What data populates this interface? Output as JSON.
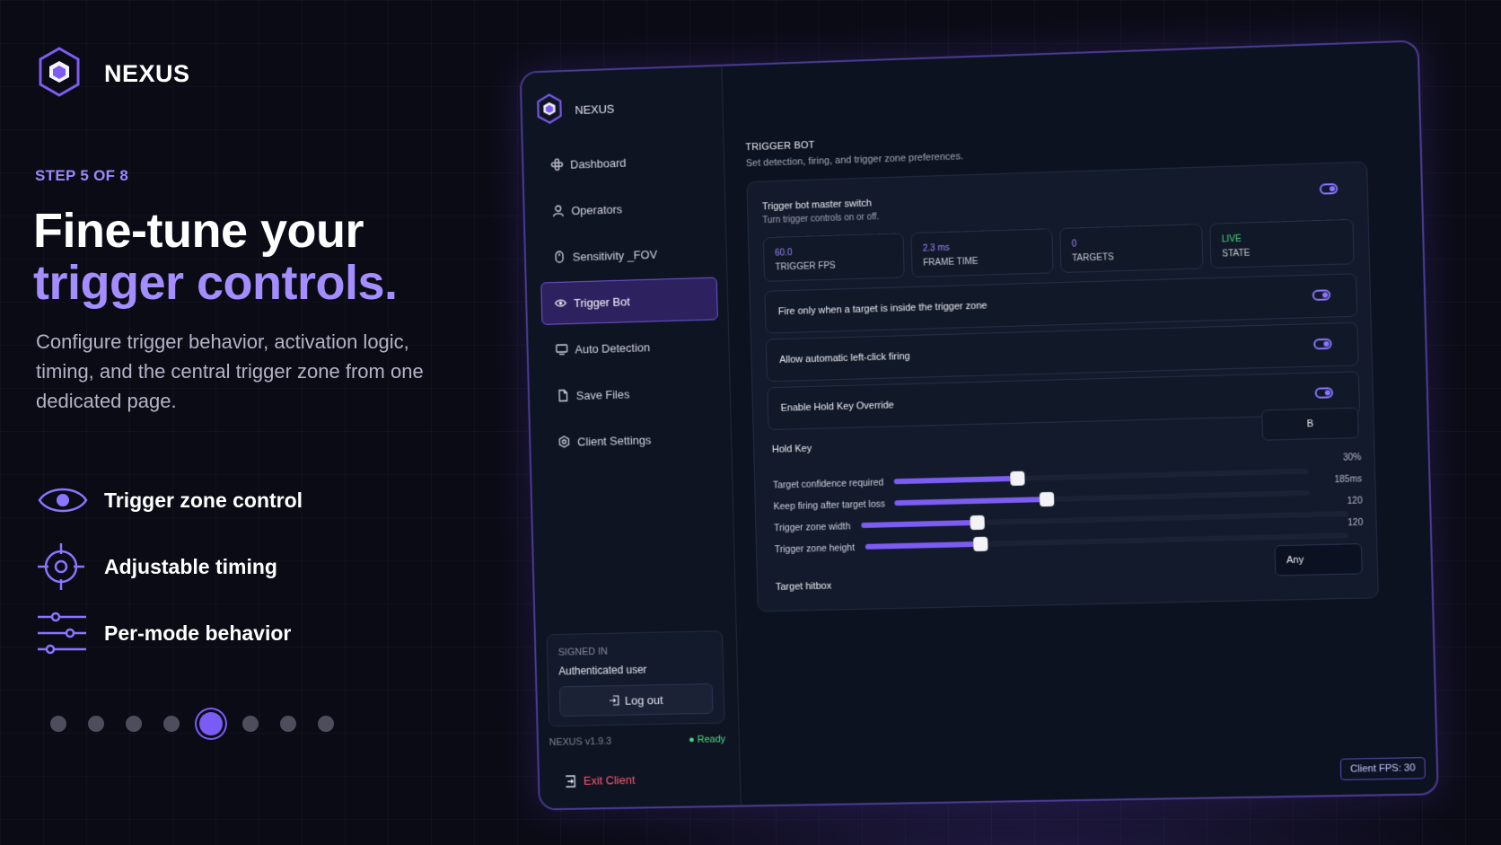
{
  "brand": {
    "name": "NEXUS"
  },
  "step": "STEP 5 OF 8",
  "headline": {
    "line1": "Fine-tune your",
    "line2": "trigger controls."
  },
  "lead": "Configure trigger behavior, activation logic, timing, and the central trigger zone from one dedicated page.",
  "features": [
    {
      "icon": "eye-icon",
      "label": "Trigger zone control"
    },
    {
      "icon": "crosshair-icon",
      "label": "Adjustable timing"
    },
    {
      "icon": "sliders-icon",
      "label": "Per-mode behavior"
    }
  ],
  "pagination": {
    "total": 8,
    "current": 5
  },
  "colors": {
    "accent": "#7c5cf2",
    "accent_light": "#a48dff",
    "ready": "#4ade80",
    "danger": "#ff5a6e",
    "background": "#0b0b16"
  },
  "app": {
    "brand_name": "NEXUS",
    "nav": [
      {
        "icon": "dashboard-icon",
        "label": "Dashboard"
      },
      {
        "icon": "user-icon",
        "label": "Operators"
      },
      {
        "icon": "mouse-icon",
        "label": "Sensitivity _FOV"
      },
      {
        "icon": "eye-icon",
        "label": "Trigger Bot",
        "active": true
      },
      {
        "icon": "monitor-icon",
        "label": "Auto Detection"
      },
      {
        "icon": "file-icon",
        "label": "Save Files"
      },
      {
        "icon": "settings-icon",
        "label": "Client Settings"
      }
    ],
    "signed_in": {
      "caption": "SIGNED IN",
      "user": "Authenticated user",
      "logout_label": "Log out"
    },
    "version": "NEXUS v1.9.3",
    "status": "● Ready",
    "exit_label": "Exit Client",
    "client_fps": "Client FPS: 30"
  },
  "page": {
    "title": "TRIGGER BOT",
    "subtitle": "Set detection, firing, and trigger zone preferences.",
    "master": {
      "title": "Trigger bot master switch",
      "subtitle": "Turn trigger controls on or off.",
      "enabled": true
    },
    "stats": [
      {
        "value": "60.0",
        "label": "TRIGGER FPS"
      },
      {
        "value": "2.3 ms",
        "label": "FRAME TIME"
      },
      {
        "value": "0",
        "label": "TARGETS"
      },
      {
        "value": "LIVE",
        "label": "STATE"
      }
    ],
    "toggles": [
      {
        "label": "Fire only when a target is inside the trigger zone",
        "enabled": true
      },
      {
        "label": "Allow automatic left-click firing",
        "enabled": true
      },
      {
        "label": "Enable Hold Key Override",
        "enabled": true
      }
    ],
    "hold_key": {
      "label": "Hold Key",
      "value": "B"
    },
    "sliders": [
      {
        "label": "Target confidence required",
        "display": "30%",
        "fraction": 0.3
      },
      {
        "label": "Keep firing after target loss",
        "display": "185ms",
        "fraction": 0.37
      },
      {
        "label": "Trigger zone width",
        "display": "120",
        "fraction": 0.24
      },
      {
        "label": "Trigger zone height",
        "display": "120",
        "fraction": 0.24
      }
    ],
    "hitbox": {
      "label": "Target hitbox",
      "value": "Any"
    }
  }
}
